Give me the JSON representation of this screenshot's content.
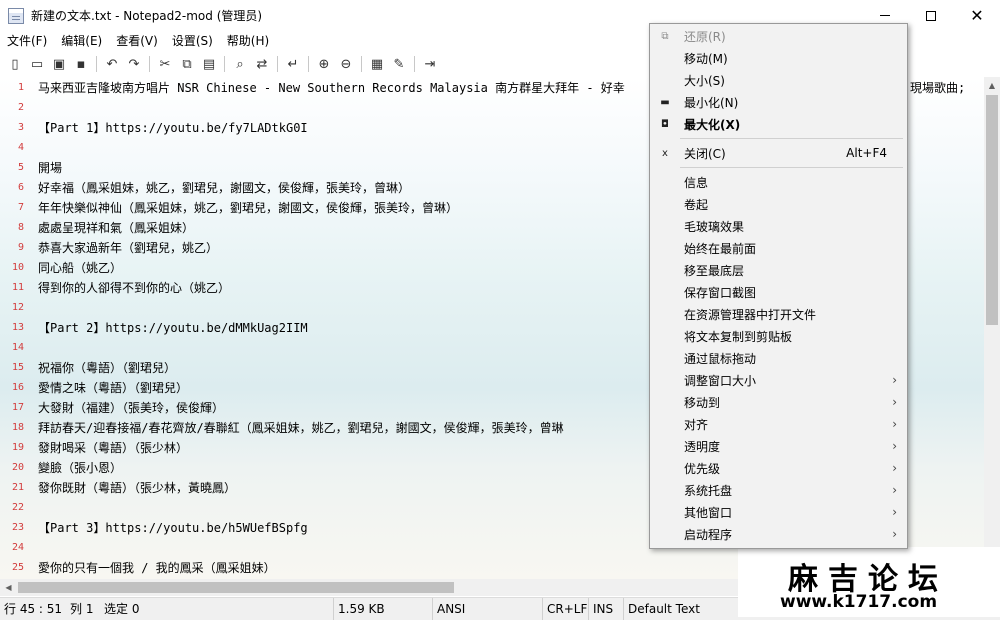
{
  "window": {
    "title": "新建の文本.txt - Notepad2-mod (管理员)",
    "close_glyph": "✕"
  },
  "menubar": [
    "文件(F)",
    "编辑(E)",
    "查看(V)",
    "设置(S)",
    "帮助(H)"
  ],
  "toolbar": {
    "groups": [
      [
        {
          "icon": "new-file-icon",
          "glyph": "▯"
        },
        {
          "icon": "open-folder-icon",
          "glyph": "▭"
        },
        {
          "icon": "browse-icon",
          "glyph": "▣"
        },
        {
          "icon": "save-icon",
          "glyph": "▪"
        }
      ],
      [
        {
          "icon": "undo-icon",
          "glyph": "↶"
        },
        {
          "icon": "redo-icon",
          "glyph": "↷"
        }
      ],
      [
        {
          "icon": "cut-icon",
          "glyph": "✂"
        },
        {
          "icon": "copy-icon",
          "glyph": "⧉"
        },
        {
          "icon": "paste-icon",
          "glyph": "▤"
        }
      ],
      [
        {
          "icon": "find-icon",
          "glyph": "⌕"
        },
        {
          "icon": "replace-icon",
          "glyph": "⇄"
        }
      ],
      [
        {
          "icon": "word-wrap-icon",
          "glyph": "↵"
        }
      ],
      [
        {
          "icon": "zoom-in-icon",
          "glyph": "⊕"
        },
        {
          "icon": "zoom-out-icon",
          "glyph": "⊖"
        }
      ],
      [
        {
          "icon": "scheme-icon",
          "glyph": "▦"
        },
        {
          "icon": "customize-scheme-icon",
          "glyph": "✎"
        }
      ],
      [
        {
          "icon": "exit-icon",
          "glyph": "⇥"
        }
      ]
    ]
  },
  "editor": {
    "lines": [
      {
        "n": "1",
        "text": "马来西亚吉隆坡南方唱片 NSR Chinese - New Southern Records Malaysia 南方群星大拜年 - 好幸"
      },
      {
        "n": "2",
        "text": ""
      },
      {
        "n": "3",
        "text": "【Part 1】https://youtu.be/fy7LADtkG0I"
      },
      {
        "n": "4",
        "text": ""
      },
      {
        "n": "5",
        "text": "開場"
      },
      {
        "n": "6",
        "text": "好幸福（鳳采姐妹，姚乙，劉珺兒，謝國文，侯俊輝，張美玲，曾琳）"
      },
      {
        "n": "7",
        "text": "年年快樂似神仙（鳳采姐妹，姚乙，劉珺兒，謝國文，侯俊輝，張美玲，曾琳）"
      },
      {
        "n": "8",
        "text": "處處呈現祥和氣（鳳采姐妹）"
      },
      {
        "n": "9",
        "text": "恭喜大家過新年（劉珺兒，姚乙）"
      },
      {
        "n": "10",
        "text": "同心船（姚乙）"
      },
      {
        "n": "11",
        "text": "得到你的人卻得不到你的心（姚乙）"
      },
      {
        "n": "12",
        "text": ""
      },
      {
        "n": "13",
        "text": "【Part 2】https://youtu.be/dMMkUag2IIM"
      },
      {
        "n": "14",
        "text": ""
      },
      {
        "n": "15",
        "text": "祝福你（粵語）（劉珺兒）"
      },
      {
        "n": "16",
        "text": "愛情之味（粵語）（劉珺兒）"
      },
      {
        "n": "17",
        "text": "大發財（福建）（張美玲，侯俊輝）"
      },
      {
        "n": "18",
        "text": "拜訪春天/迎春接福/春花齊放/春聯紅（鳳采姐妹，姚乙，劉珺兒，謝國文，侯俊輝，張美玲，曾琳"
      },
      {
        "n": "19",
        "text": "發財喝采（粵語）（張少林）"
      },
      {
        "n": "20",
        "text": "變臉（張小恩）"
      },
      {
        "n": "21",
        "text": "發你既財（粵語）（張少林，黃曉鳳）"
      },
      {
        "n": "22",
        "text": ""
      },
      {
        "n": "23",
        "text": "【Part 3】https://youtu.be/h5WUefBSpfg"
      },
      {
        "n": "24",
        "text": ""
      },
      {
        "n": "25",
        "text": "愛你的只有一個我 / 我的鳳采（鳳采姐妹）"
      }
    ],
    "line1_tail": "現場歌曲;"
  },
  "context_menu": {
    "items": [
      {
        "label": "还原(R)",
        "icon": "restore-icon",
        "glyph": "⧉",
        "disabled": true
      },
      {
        "label": "移动(M)"
      },
      {
        "label": "大小(S)"
      },
      {
        "label": "最小化(N)",
        "icon": "minimize-icon",
        "glyph": "▬"
      },
      {
        "label": "最大化(X)",
        "icon": "maximize-icon",
        "glyph": "◘",
        "bold": true
      },
      {
        "sep": true
      },
      {
        "label": "关闭(C)",
        "icon": "close-icon",
        "glyph": "x",
        "shortcut": "Alt+F4"
      },
      {
        "sep": true
      },
      {
        "label": "信息"
      },
      {
        "label": "卷起"
      },
      {
        "label": "毛玻璃效果"
      },
      {
        "label": "始终在最前面"
      },
      {
        "label": "移至最底层"
      },
      {
        "label": "保存窗口截图"
      },
      {
        "label": "在资源管理器中打开文件"
      },
      {
        "label": "将文本复制到剪贴板"
      },
      {
        "label": "通过鼠标拖动"
      },
      {
        "label": "调整窗口大小",
        "submenu": true
      },
      {
        "label": "移动到",
        "submenu": true
      },
      {
        "label": "对齐",
        "submenu": true
      },
      {
        "label": "透明度",
        "submenu": true
      },
      {
        "label": "优先级",
        "submenu": true
      },
      {
        "label": "系统托盘",
        "submenu": true
      },
      {
        "label": "其他窗口",
        "submenu": true
      },
      {
        "label": "启动程序",
        "submenu": true
      }
    ],
    "submenu_glyph": "›"
  },
  "statusbar": {
    "position": "行 45 : 51",
    "column": "列 1",
    "selection": "选定 0",
    "size": "1.59 KB",
    "encoding": "ANSI",
    "line_ending": "CR+LF",
    "mode": "INS",
    "scheme": "Default Text"
  },
  "watermark": {
    "title": "麻吉论坛",
    "url": "www.k1717.com"
  },
  "scroll_glyphs": {
    "up": "▲",
    "down": "▼",
    "left": "◀"
  }
}
